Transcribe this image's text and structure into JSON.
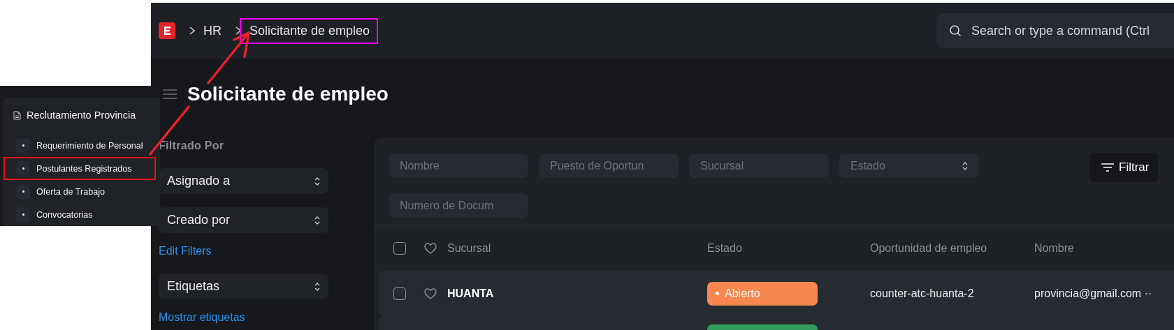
{
  "inset_sidebar": {
    "section": "Reclutamiento Provincia",
    "items": [
      {
        "label": "Requerimiento de Personal",
        "annotated": false
      },
      {
        "label": "Postulantes Registrados",
        "annotated": true
      },
      {
        "label": "Oferta de Trabajo",
        "annotated": false
      },
      {
        "label": "Convocatorias",
        "annotated": false
      }
    ]
  },
  "navbar": {
    "breadcrumbs": [
      {
        "label": "HR",
        "annotated": false
      },
      {
        "label": "Solicitante de empleo",
        "annotated": true
      }
    ],
    "search": {
      "placeholder": "Search or type a command (Ctrl"
    }
  },
  "page_title": "Solicitante de empleo",
  "sidebar": {
    "heading": "Filtrado Por",
    "items": [
      {
        "kind": "select",
        "label": "Asignado a"
      },
      {
        "kind": "select",
        "label": "Creado por"
      },
      {
        "kind": "link",
        "label": "Edit Filters"
      },
      {
        "kind": "select",
        "label": "Etiquetas"
      },
      {
        "kind": "link",
        "label": "Mostrar etiquetas"
      }
    ]
  },
  "filters": {
    "fields": [
      {
        "kind": "text",
        "placeholder": "Nombre"
      },
      {
        "kind": "text",
        "placeholder": "Puesto de Oportun"
      },
      {
        "kind": "text",
        "placeholder": "Sucursal"
      },
      {
        "kind": "select",
        "placeholder": "Estado"
      },
      {
        "kind": "text",
        "placeholder": "Numero de Docum"
      }
    ],
    "button": "Filtrar"
  },
  "table": {
    "select_all_checked": false,
    "columns": [
      "Sucursal",
      "Estado",
      "Oportunidad de empleo",
      "Nombre"
    ],
    "rows": [
      {
        "checked": false,
        "liked": false,
        "sucursal": "HUANTA",
        "estado": "Abierto",
        "color": "#f7874f",
        "oportunidad": "counter-atc-huanta-2",
        "nombre": "provincia@gmail.com ··"
      },
      {
        "color": "#2f9a5a"
      }
    ]
  }
}
